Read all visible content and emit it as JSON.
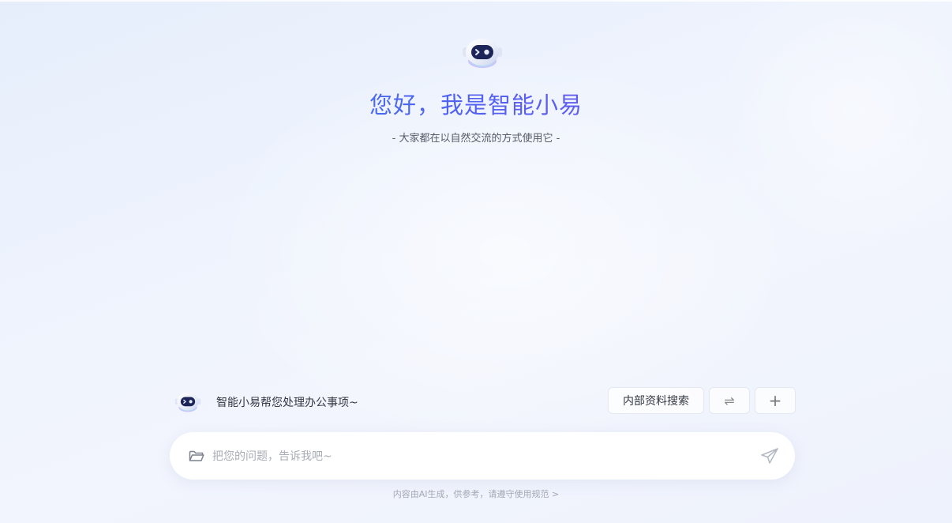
{
  "hero": {
    "title": "您好，我是智能小易",
    "subtitle": "- 大家都在以自然交流的方式使用它 -",
    "avatar_icon": "robot-avatar-icon"
  },
  "assistant": {
    "label": "智能小易帮您处理办公事项~",
    "search_button": "内部资料搜索",
    "switch_icon": "⇌",
    "add_icon": "+"
  },
  "input": {
    "placeholder": "把您的问题，告诉我吧~",
    "value": "",
    "folder_icon": "folder-icon",
    "send_icon": "send-icon"
  },
  "footer": {
    "note": "内容由AI生成，供参考，请遵守使用规范 >"
  },
  "colors": {
    "title_gradient_start": "#2a8cf7",
    "title_gradient_end": "#8a4cf0",
    "background": "#eef3fd"
  }
}
